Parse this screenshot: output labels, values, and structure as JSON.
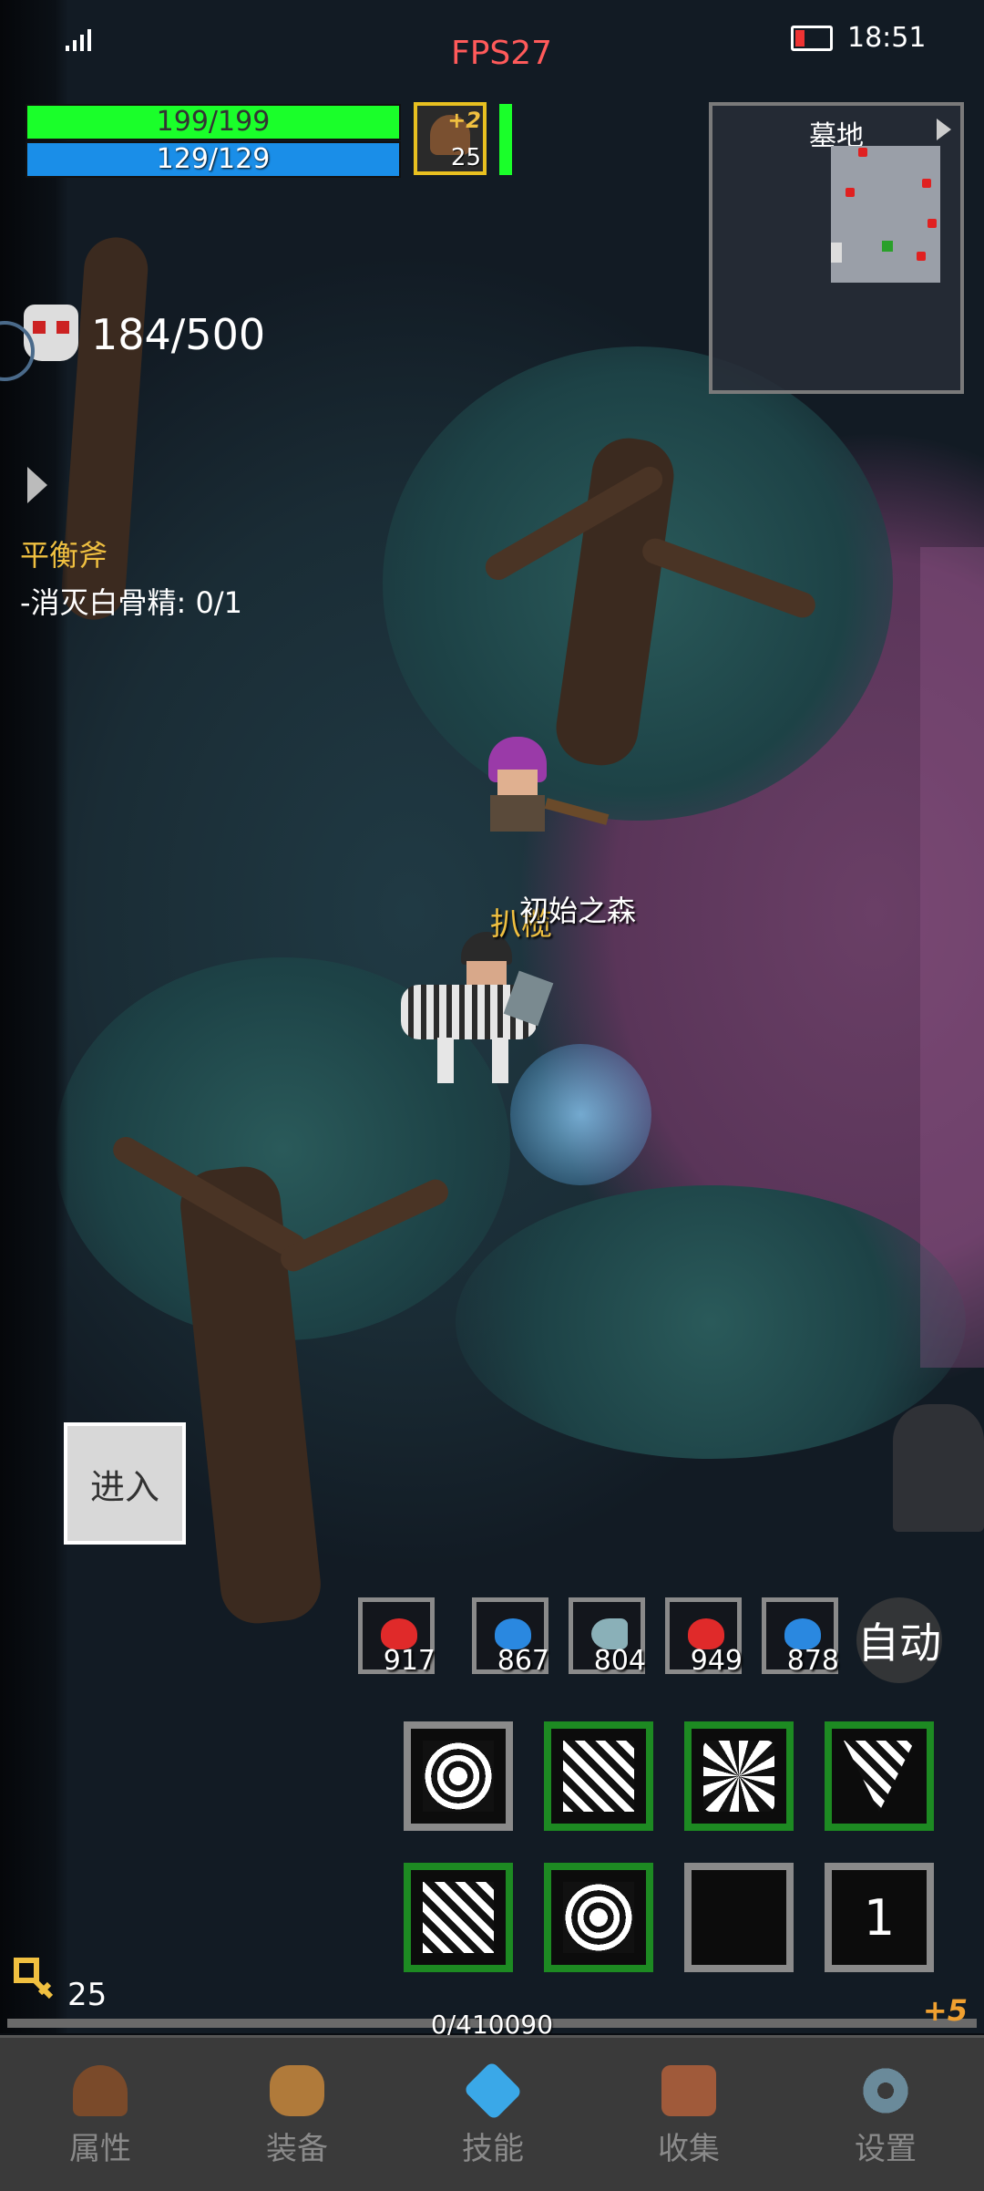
{
  "status_bar": {
    "left_icon": "signal-icon",
    "fps": "FPS27",
    "time": "18:51"
  },
  "player": {
    "hp": "199/199",
    "mp": "129/129",
    "portrait_bonus": "+2",
    "level": "25",
    "hp_fraction": 1.0,
    "mp_fraction": 1.0
  },
  "minimap": {
    "area": "墓地"
  },
  "kill_counter": "184/500",
  "quest": {
    "title": "平衡斧",
    "objective": "-消灭白骨精: 0/1"
  },
  "scene": {
    "player_name": "扒榄",
    "zone_label": "初始之森"
  },
  "enter_button": "进入",
  "potions": [
    {
      "count": "917",
      "icon": "red-potion-icon"
    },
    {
      "count": "867",
      "icon": "blue-potion-icon"
    },
    {
      "count": "804",
      "icon": "fish-icon"
    },
    {
      "count": "949",
      "icon": "red-potion-icon"
    },
    {
      "count": "878",
      "icon": "blue-potion-icon"
    }
  ],
  "auto_button": "自动",
  "skill_page": "1",
  "currency": "25",
  "exp": "0/410090",
  "exp_bonus": "+5",
  "exp_fraction": 0.0,
  "nav": [
    {
      "label": "属性",
      "icon": "helmet-icon"
    },
    {
      "label": "装备",
      "icon": "bag-icon"
    },
    {
      "label": "技能",
      "icon": "crystal-icon"
    },
    {
      "label": "收集",
      "icon": "book-icon"
    },
    {
      "label": "设置",
      "icon": "gear-icon"
    }
  ],
  "colors": {
    "hp": "#1aff2a",
    "mp": "#1a8ee8",
    "fps": "#ff5a5a",
    "quest_title": "#f0c040",
    "skill_border": "#1d8a22"
  }
}
